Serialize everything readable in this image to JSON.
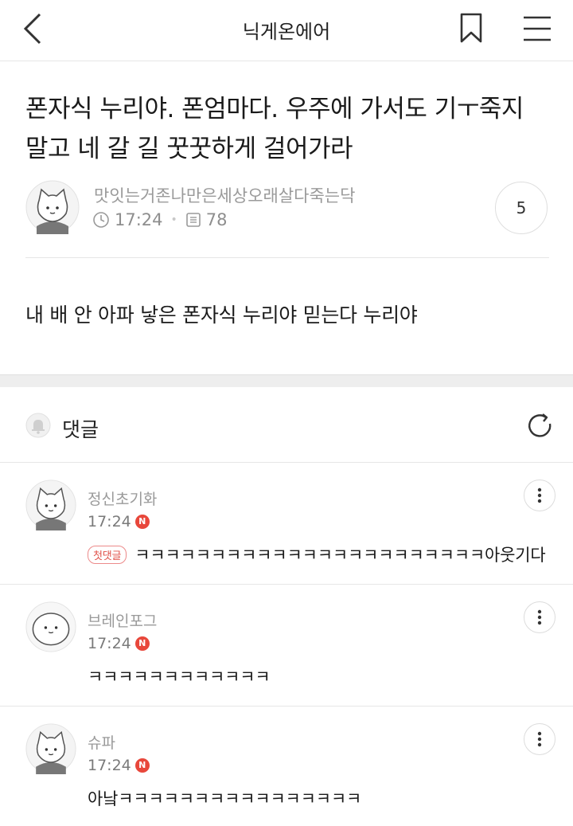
{
  "header": {
    "title": "닉게온에어",
    "back_icon": "chevron-left-icon",
    "bookmark_icon": "bookmark-icon",
    "menu_icon": "hamburger-menu-icon"
  },
  "post": {
    "title": "폰자식 누리야. 폰엄마다. 우주에 가서도 기ㅜ죽지 말고 네 갈 길 꿋꿋하게 걸어가라",
    "author": "맛잇는거존나만은세상오래살다죽는닥",
    "time": "17:24",
    "views": "78",
    "comment_count": "5",
    "body": "내 배 안 아파 낳은 폰자식 누리야 믿는다 누리야"
  },
  "comments_section": {
    "label": "댓글",
    "bell_icon": "bell-icon",
    "refresh_icon": "refresh-icon"
  },
  "comments": [
    {
      "name": "정신초기화",
      "time": "17:24",
      "badge": "N",
      "first_label": "첫댓글",
      "text": "ㅋㅋㅋㅋㅋㅋㅋㅋㅋㅋㅋㅋㅋㅋㅋㅋㅋㅋㅋㅋㅋㅋㅋ아웃기다"
    },
    {
      "name": "브레인포그",
      "time": "17:24",
      "badge": "N",
      "text": "ㅋㅋㅋㅋㅋㅋㅋㅋㅋㅋㅋㅋ"
    },
    {
      "name": "슈파",
      "time": "17:24",
      "badge": "N",
      "text": "아낰ㅋㅋㅋㅋㅋㅋㅋㅋㅋㅋㅋㅋㅋㅋㅋㅋ"
    }
  ],
  "colors": {
    "badge_red": "#e8473b",
    "first_badge_border": "#ec8a8a",
    "muted_text": "#9a9a9a",
    "section_gap": "#eeeeee"
  }
}
